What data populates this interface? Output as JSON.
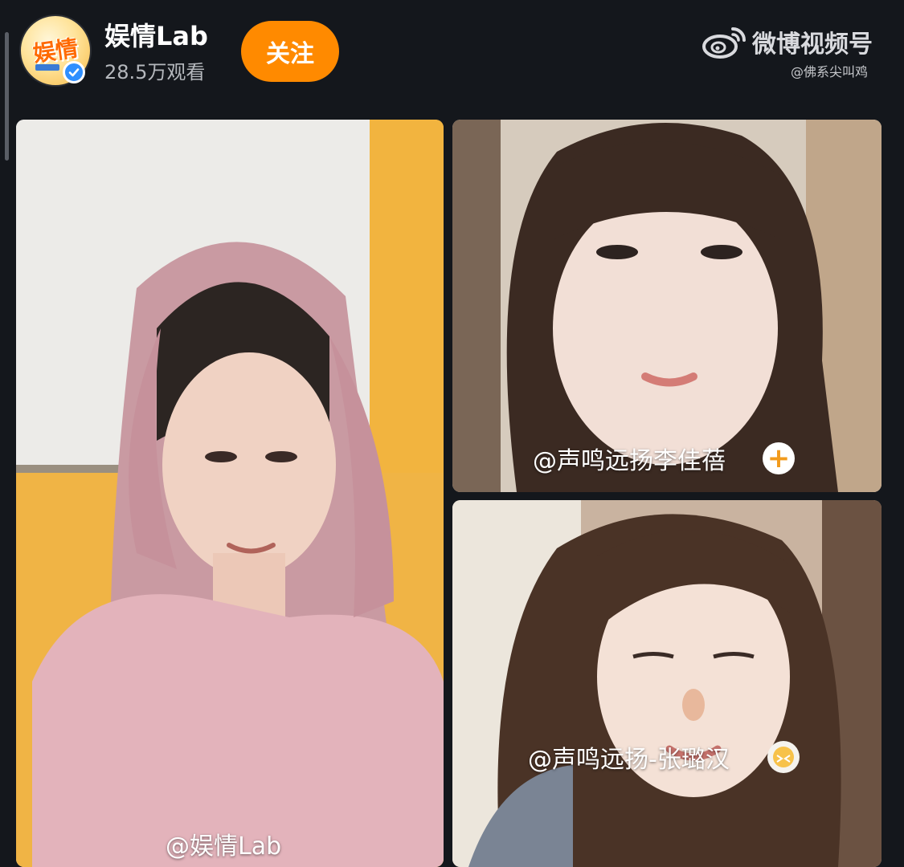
{
  "header": {
    "channel_name": "娱情Lab",
    "viewer_count": "28.5万观看",
    "follow_label": "关注",
    "avatar_icon": "yuqing-logo-icon",
    "verified_icon": "verified-check-icon"
  },
  "watermark": {
    "title": "微博视频号",
    "handle": "@佛系尖叫鸡",
    "logo_icon": "weibo-logo-icon"
  },
  "tiles": [
    {
      "label": "@娱情Lab"
    },
    {
      "label": "@声鸣远扬李佳蓓",
      "action_icon": "plus-icon"
    },
    {
      "label": "@声鸣远扬-张璐汉",
      "action_icon": "emoji-icon"
    }
  ],
  "colors": {
    "background": "#14171c",
    "accent": "#ff8a00",
    "verified": "#2f8fff"
  }
}
